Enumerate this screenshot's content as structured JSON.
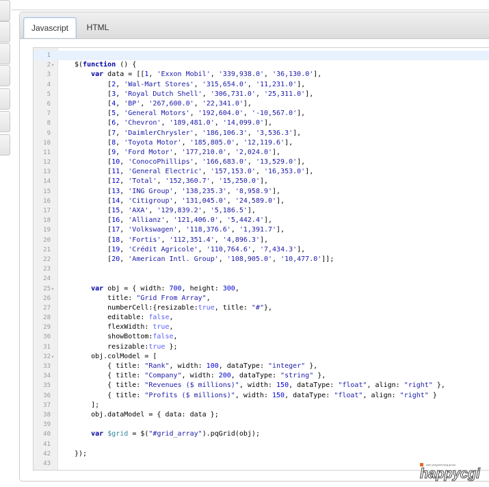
{
  "tabs": [
    {
      "label": "Javascript",
      "active": true
    },
    {
      "label": "HTML",
      "active": false
    }
  ],
  "code_lines": [
    "",
    "$(function () {",
    "    var data = [[1, 'Exxon Mobil', '339,938.0', '36,130.0'],",
    "        [2, 'Wal-Mart Stores', '315,654.0', '11,231.0'],",
    "        [3, 'Royal Dutch Shell', '306,731.0', '25,311.0'],",
    "        [4, 'BP', '267,600.0', '22,341.0'],",
    "        [5, 'General Motors', '192,604.0', '-10,567.0'],",
    "        [6, 'Chevron', '189,481.0', '14,099.0'],",
    "        [7, 'DaimlerChrysler', '186,106.3', '3,536.3'],",
    "        [8, 'Toyota Motor', '185,805.0', '12,119.6'],",
    "        [9, 'Ford Motor', '177,210.0', '2,024.0'],",
    "        [10, 'ConocoPhillips', '166,683.0', '13,529.0'],",
    "        [11, 'General Electric', '157,153.0', '16,353.0'],",
    "        [12, 'Total', '152,360.7', '15,250.0'],",
    "        [13, 'ING Group', '138,235.3', '8,958.9'],",
    "        [14, 'Citigroup', '131,045.0', '24,589.0'],",
    "        [15, 'AXA', '129,839.2', '5,186.5'],",
    "        [16, 'Allianz', '121,406.0', '5,442.4'],",
    "        [17, 'Volkswagen', '118,376.6', '1,391.7'],",
    "        [18, 'Fortis', '112,351.4', '4,896.3'],",
    "        [19, 'Crédit Agricole', '110,764.6', '7,434.3'],",
    "        [20, 'American Intl. Group', '108,905.0', '10,477.0']];",
    "",
    "",
    "    var obj = { width: 700, height: 300,",
    "        title: \"Grid From Array\",",
    "        numberCell:{resizable:true, title: \"#\"},",
    "        editable: false,",
    "        flexWidth: true,",
    "        showBottom:false,",
    "        resizable:true };",
    "    obj.colModel = [",
    "        { title: \"Rank\", width: 100, dataType: \"integer\" },",
    "        { title: \"Company\", width: 200, dataType: \"string\" },",
    "        { title: \"Revenues ($ millions)\", width: 150, dataType: \"float\", align: \"right\" },",
    "        { title: \"Profits ($ millions)\", width: 150, dataType: \"float\", align: \"right\" }",
    "    ];",
    "    obj.dataModel = { data: data };",
    "",
    "    var $grid = $(\"#grid_array\").pqGrid(obj);",
    "",
    "});",
    ""
  ],
  "fold_lines": [
    2,
    25,
    32
  ],
  "fold_icon": "fold-arrow-icon",
  "logo": {
    "subtitle": "web programming group",
    "name": "happycgi",
    "accent": "#e06b24"
  }
}
